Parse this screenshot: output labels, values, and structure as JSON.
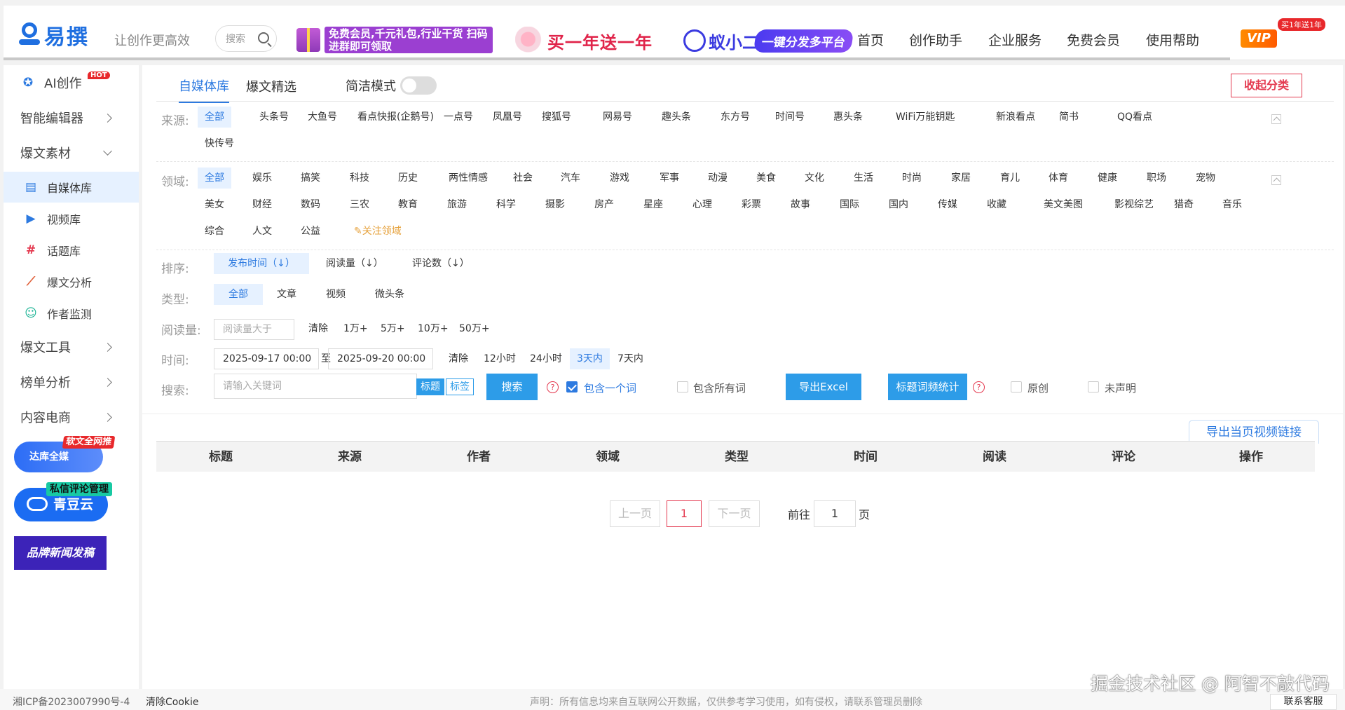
{
  "header": {
    "logo_text": "易撰",
    "slogan": "让创作更高效",
    "search_placeholder": "搜索",
    "ad1_text": "免费会员,千元礼包,行业干货 扫码进群即可领取",
    "ad2_text": "买一年送一年",
    "ad3_name": "蚁小二",
    "ad3_pill": "一键分发多平台",
    "nav": [
      "首页",
      "创作助手",
      "企业服务",
      "免费会员",
      "使用帮助"
    ],
    "vip_label": "VIP",
    "vip_badge": "买1年送1年"
  },
  "sidebar": {
    "ai": "AI创作",
    "hot": "HOT",
    "editor": "智能编辑器",
    "material": "爆文素材",
    "sub": [
      "自媒体库",
      "视频库",
      "话题库",
      "爆文分析",
      "作者监测"
    ],
    "tools": "爆文工具",
    "rank": "榜单分析",
    "ecom": "内容电商",
    "promo1_text": "达库全媒",
    "promo1_tag": "软文全网推",
    "promo2_text": "青豆云",
    "promo2_tag": "私信评论管理",
    "promo3_text": "品牌新闻发稿"
  },
  "tabs": {
    "items": [
      "自媒体库",
      "爆文精选"
    ],
    "simple_mode": "简洁模式",
    "collapse": "收起分类"
  },
  "filters": {
    "source_label": "来源:",
    "sources": [
      "全部",
      "头条号",
      "大鱼号",
      "看点快报(企鹅号)",
      "一点号",
      "凤凰号",
      "搜狐号",
      "网易号",
      "趣头条",
      "东方号",
      "时间号",
      "惠头条",
      "WiFi万能钥匙",
      "新浪看点",
      "简书",
      "QQ看点",
      "快传号"
    ],
    "domain_label": "领域:",
    "domains_row1": [
      "全部",
      "娱乐",
      "搞笑",
      "科技",
      "历史",
      "两性情感",
      "社会",
      "汽车",
      "游戏",
      "军事",
      "动漫",
      "美食",
      "文化",
      "生活",
      "时尚",
      "家居",
      "育儿",
      "体育",
      "健康",
      "职场",
      "宠物"
    ],
    "domains_row2": [
      "美女",
      "财经",
      "数码",
      "三农",
      "教育",
      "旅游",
      "科学",
      "摄影",
      "房产",
      "星座",
      "心理",
      "彩票",
      "故事",
      "国际",
      "国内",
      "传媒",
      "收藏",
      "美文美图",
      "影视综艺",
      "猎奇",
      "音乐"
    ],
    "domains_row3": [
      "综合",
      "人文",
      "公益"
    ],
    "follow": "关注领域",
    "sort_label": "排序:",
    "sorts": [
      "发布时间（↓）",
      "阅读量（↓）",
      "评论数（↓）"
    ],
    "type_label": "类型:",
    "types": [
      "全部",
      "文章",
      "视频",
      "微头条"
    ],
    "read_label": "阅读量:",
    "read_placeholder": "阅读量大于",
    "read_opts": [
      "清除",
      "1万+",
      "5万+",
      "10万+",
      "50万+"
    ],
    "time_label": "时间:",
    "time_start": "2025-09-17 00:00",
    "time_to": "至",
    "time_end": "2025-09-20 00:00",
    "time_opts": [
      "清除",
      "12小时",
      "24小时",
      "3天内",
      "7天内"
    ],
    "search_label": "搜索:",
    "search_placeholder": "请输入关键词",
    "mode_title": "标题",
    "mode_tag": "标签",
    "search_btn": "搜索",
    "contains_one": "包含一个词",
    "contains_all": "包含所有词",
    "export_excel": "导出Excel",
    "title_freq": "标题词频统计",
    "original": "原创",
    "undeclared": "未声明"
  },
  "table": {
    "export_link": "导出当页视频链接",
    "columns": [
      "标题",
      "来源",
      "作者",
      "领域",
      "类型",
      "时间",
      "阅读",
      "评论",
      "操作"
    ]
  },
  "pager": {
    "prev": "上一页",
    "current": "1",
    "next": "下一页",
    "goto": "前往",
    "goto_value": "1",
    "page_unit": "页"
  },
  "footer": {
    "icp": "湘ICP备2023007990号-4",
    "clear_cookie": "清除Cookie",
    "disclaimer": "声明：所有信息均来自互联网公开数据，仅供参考学习使用，如有侵权，请联系管理员删除",
    "watermark": "掘金技术社区 @ 阿智不敲代码",
    "service": "联系客服"
  },
  "colors": {
    "accent": "#2d7ae0",
    "danger": "#e4394f",
    "button": "#2d9ce8"
  }
}
